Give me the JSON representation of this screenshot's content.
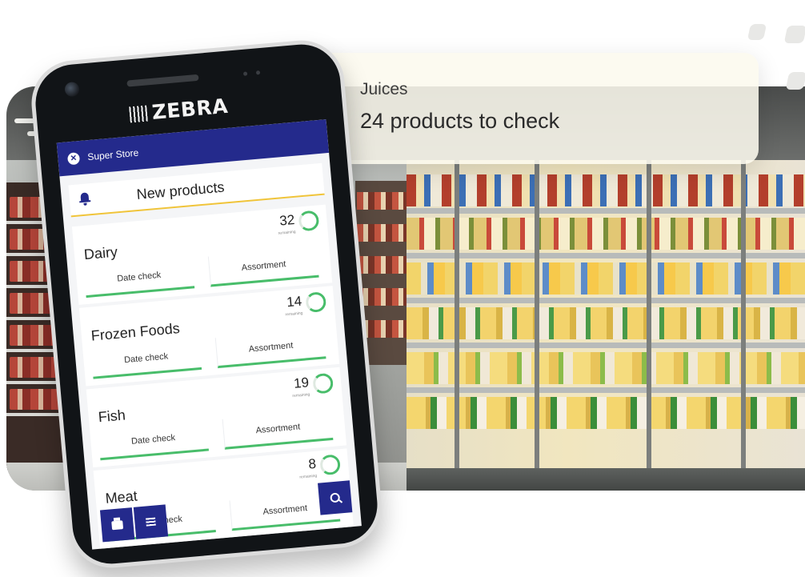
{
  "notification": {
    "title": "Juices",
    "message": "24 products to check",
    "badge": "!",
    "badge_color": "#48bd6a"
  },
  "device": {
    "brand": "ZEBRA"
  },
  "app": {
    "header_title": "Super Store",
    "header_color": "#242a8c",
    "section_title": "New products",
    "accent_color": "#48bd6a",
    "categories": [
      {
        "name": "Dairy",
        "count": "32",
        "count_caption": "remaining",
        "actions": [
          "Date check",
          "Assortment"
        ]
      },
      {
        "name": "Frozen Foods",
        "count": "14",
        "count_caption": "remaining",
        "actions": [
          "Date check",
          "Assortment"
        ]
      },
      {
        "name": "Fish",
        "count": "19",
        "count_caption": "remaining",
        "actions": [
          "Date check",
          "Assortment"
        ]
      },
      {
        "name": "Meat",
        "count": "8",
        "count_caption": "remaining",
        "actions": [
          "Date check",
          "Assortment"
        ]
      }
    ],
    "fab_icons": [
      "print-icon",
      "list-icon",
      "search-icon"
    ]
  }
}
